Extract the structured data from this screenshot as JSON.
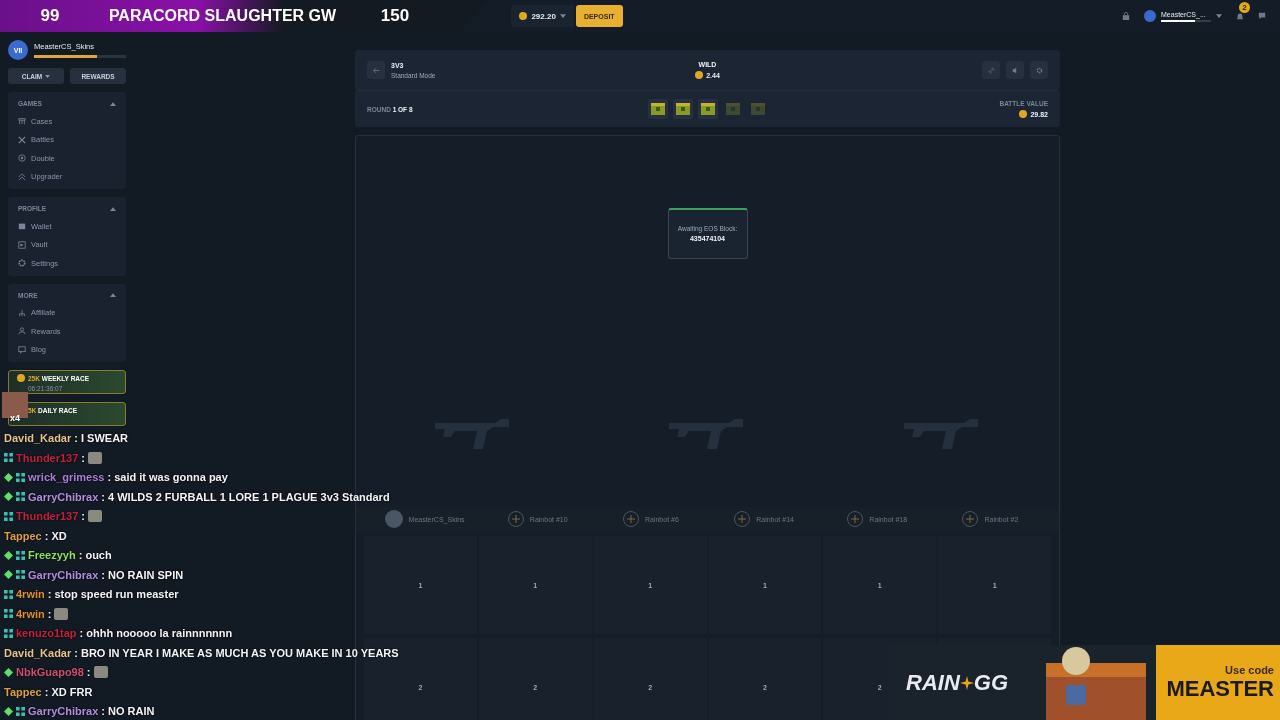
{
  "stream_banner": {
    "left_count": "99",
    "title": "PARACORD SLAUGHTER GW",
    "right_count": "150"
  },
  "header": {
    "balance": "292.20",
    "deposit": "DEPOSIT",
    "username": "MeasterCS_...",
    "notification_count": "2"
  },
  "sidebar": {
    "username": "MeasterCS_Skins",
    "rank": "VII",
    "xp": {
      "level": 0.68
    },
    "claim": "CLAIM",
    "rewards": "REWARDS",
    "sections": [
      {
        "title": "GAMES",
        "expanded": true,
        "items": [
          {
            "kind": "cases",
            "label": "Cases"
          },
          {
            "kind": "battles",
            "label": "Battles"
          },
          {
            "kind": "double",
            "label": "Double"
          },
          {
            "kind": "upgrader",
            "label": "Upgrader"
          }
        ]
      },
      {
        "title": "PROFILE",
        "expanded": true,
        "items": [
          {
            "kind": "wallet",
            "label": "Wallet"
          },
          {
            "kind": "vault",
            "label": "Vault"
          },
          {
            "kind": "settings",
            "label": "Settings"
          }
        ]
      },
      {
        "title": "MORE",
        "expanded": true,
        "items": [
          {
            "kind": "affiliate",
            "label": "Affiliate"
          },
          {
            "kind": "rewards",
            "label": "Rewards"
          },
          {
            "kind": "blog",
            "label": "Blog"
          }
        ]
      }
    ],
    "races": [
      {
        "amount": "25K",
        "title": "WEEKLY RACE",
        "timer": "06:21:36:07"
      },
      {
        "amount": "5K",
        "title": "DAILY RACE"
      }
    ]
  },
  "battle": {
    "mode": "3V3",
    "mode_detail": "Standard Mode",
    "case_name": "WILD",
    "case_price": "2.44",
    "round": "ROUND **1 OF 8**",
    "battle_value_label": "BATTLE VALUE",
    "battle_value": "29.82",
    "cases": [
      {
        "faded": false
      },
      {
        "faded": false
      },
      {
        "faded": false
      },
      {
        "faded": true
      },
      {
        "faded": true
      }
    ],
    "status_label": "Awaiting EOS Block:",
    "status_value": "435474104",
    "players": [
      {
        "kind": "user",
        "name": "MeasterCS_Skins"
      },
      {
        "kind": "bot",
        "name": "Rainbot #10"
      },
      {
        "kind": "bot",
        "name": "Rainbot #6"
      },
      {
        "kind": "bot",
        "name": "Rainbot #14"
      },
      {
        "kind": "bot",
        "name": "Rainbot #18"
      },
      {
        "kind": "bot",
        "name": "Rainbot #2"
      }
    ],
    "rounds": [
      [
        "1",
        "1",
        "1",
        "1",
        "1",
        "1"
      ],
      [
        "2",
        "2",
        "2",
        "2",
        "2"
      ]
    ]
  },
  "webcam": {
    "label": "x4"
  },
  "chat": [
    {
      "user": "David_Kadar",
      "color": "#e8c48a",
      "vip": false,
      "sub": false,
      "emote": false,
      "message": ": I SWEAR"
    },
    {
      "user": "Thunder137",
      "color": "#c0213a",
      "vip": false,
      "sub": true,
      "emote": true,
      "message": ":"
    },
    {
      "user": "wrick_grimess",
      "color": "#b07ad8",
      "vip": true,
      "sub": true,
      "emote": false,
      "message": ": said it was gonna pay"
    },
    {
      "user": "GarryChibrax",
      "color": "#b58de0",
      "vip": true,
      "sub": true,
      "emote": false,
      "message": ": 4 WILDS 2 FURBALL 1 LORE 1 PLAGUE 3v3 Standard"
    },
    {
      "user": "Thunder137",
      "color": "#c0213a",
      "vip": false,
      "sub": true,
      "emote": true,
      "message": ":"
    },
    {
      "user": "Tappec",
      "color": "#e0a040",
      "vip": false,
      "sub": false,
      "emote": false,
      "message": ": XD"
    },
    {
      "user": "Freezyyh",
      "color": "#8fe05a",
      "vip": true,
      "sub": true,
      "emote": false,
      "message": ": ouch"
    },
    {
      "user": "GarryChibrax",
      "color": "#b58de0",
      "vip": true,
      "sub": true,
      "emote": false,
      "message": ": NO RAIN SPIN"
    },
    {
      "user": "4rwin",
      "color": "#e0902a",
      "vip": false,
      "sub": true,
      "emote": false,
      "message": ": stop speed run measter"
    },
    {
      "user": "4rwin",
      "color": "#e0902a",
      "vip": false,
      "sub": true,
      "emote": true,
      "message": ":"
    },
    {
      "user": "kenuzo1tap",
      "color": "#c8203a",
      "vip": false,
      "sub": true,
      "emote": false,
      "message": ": ohhh nooooo la rainnnnnnn"
    },
    {
      "user": "David_Kadar",
      "color": "#e8c48a",
      "vip": false,
      "sub": false,
      "emote": false,
      "message": ": BRO IN YEAR I MAKE AS MUCH AS YOU MAKE IN 10 YEARS"
    },
    {
      "user": "NbkGuapo98",
      "color": "#d0506a",
      "vip": true,
      "sub": false,
      "emote": true,
      "message": ":"
    },
    {
      "user": "Tappec",
      "color": "#e0a040",
      "vip": false,
      "sub": false,
      "emote": false,
      "message": ": XD FRR"
    },
    {
      "user": "GarryChibrax",
      "color": "#b58de0",
      "vip": true,
      "sub": true,
      "emote": false,
      "message": ": NO RAIN"
    }
  ],
  "ad": {
    "logo_left": "RAIN",
    "logo_right": "GG",
    "caption": "Use code",
    "code": "MEASTER"
  }
}
